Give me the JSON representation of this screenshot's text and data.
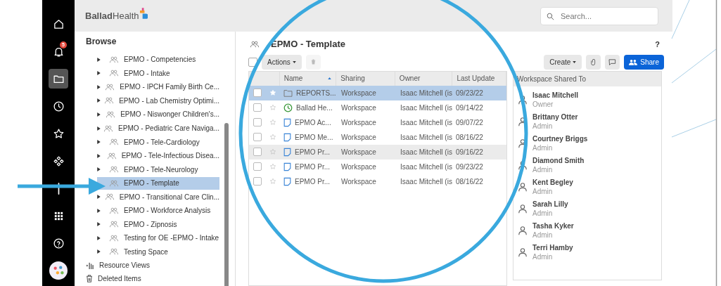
{
  "rail": [
    {
      "kind": "home",
      "selected": false
    },
    {
      "kind": "bell",
      "selected": false,
      "badge": "5"
    },
    {
      "kind": "folder",
      "selected": true
    },
    {
      "kind": "clock",
      "selected": false
    },
    {
      "kind": "star",
      "selected": false
    },
    {
      "kind": "diamonds",
      "selected": false
    },
    {
      "kind": "plus",
      "selected": false
    },
    {
      "kind": "apps",
      "selected": false
    },
    {
      "kind": "help",
      "selected": false
    },
    {
      "kind": "avatar",
      "selected": false
    }
  ],
  "header": {
    "logo": {
      "bold": "Ballad",
      "light": "Health"
    },
    "search": {
      "placeholder": "Search..."
    }
  },
  "sidebar": {
    "title": "Browse",
    "items": [
      {
        "label": "EPMO - Competencies",
        "selected": false,
        "has_children": true
      },
      {
        "label": "EPMO - Intake",
        "selected": false,
        "has_children": true
      },
      {
        "label": "EPMO - IPCH Family Birth Ce...",
        "selected": false,
        "has_children": true
      },
      {
        "label": "EPMO - Lab Chemistry Optimi...",
        "selected": false,
        "has_children": true
      },
      {
        "label": "EPMO - Niswonger Children's...",
        "selected": false,
        "has_children": true
      },
      {
        "label": "EPMO - Pediatric Care Naviga...",
        "selected": false,
        "has_children": true
      },
      {
        "label": "EPMO - Tele-Cardiology",
        "selected": false,
        "has_children": true
      },
      {
        "label": "EPMO - Tele-Infectious Disea...",
        "selected": false,
        "has_children": true
      },
      {
        "label": "EPMO - Tele-Neurology",
        "selected": false,
        "has_children": true
      },
      {
        "label": "EPMO - Template",
        "selected": true,
        "has_children": false
      },
      {
        "label": "EPMO - Transitional Care Clin...",
        "selected": false,
        "has_children": true
      },
      {
        "label": "EPMO - Workforce Analysis",
        "selected": false,
        "has_children": true
      },
      {
        "label": "EPMO - Zipnosis",
        "selected": false,
        "has_children": true
      },
      {
        "label": "Testing for OE -EPMO - Intake",
        "selected": false,
        "has_children": true
      },
      {
        "label": "Testing Space",
        "selected": false,
        "has_children": true
      }
    ],
    "footer": [
      {
        "kind": "views",
        "label": "Resource Views"
      },
      {
        "kind": "trash",
        "label": "Deleted Items"
      }
    ]
  },
  "workspace": {
    "select_all_checked": false,
    "title": "EPMO - Template",
    "help": "?",
    "actions": "Actions",
    "create": "Create",
    "share": "Share"
  },
  "table": {
    "columns": [
      "Name",
      "Sharing",
      "Owner",
      "Last Update"
    ],
    "rows": [
      {
        "kind": "folder",
        "name": "REPORTS...",
        "sharing": "Workspace",
        "owner": "Isaac Mitchell (is",
        "updated": "09/23/22",
        "checked": false,
        "selected": true,
        "hovered": false
      },
      {
        "kind": "dashboard",
        "name": "Ballad He...",
        "sharing": "Workspace",
        "owner": "Isaac Mitchell (is",
        "updated": "09/14/22",
        "checked": false,
        "selected": false,
        "hovered": false
      },
      {
        "kind": "sheet",
        "name": "EPMO Ac...",
        "sharing": "Workspace",
        "owner": "Isaac Mitchell (is",
        "updated": "09/07/22",
        "checked": false,
        "selected": false,
        "hovered": false
      },
      {
        "kind": "sheet",
        "name": "EPMO Me...",
        "sharing": "Workspace",
        "owner": "Isaac Mitchell (is",
        "updated": "08/16/22",
        "checked": false,
        "selected": false,
        "hovered": false
      },
      {
        "kind": "sheet",
        "name": "EPMO Pr...",
        "sharing": "Workspace",
        "owner": "Isaac Mitchell (is",
        "updated": "09/16/22",
        "checked": false,
        "selected": false,
        "hovered": true
      },
      {
        "kind": "sheet",
        "name": "EPMO Pr...",
        "sharing": "Workspace",
        "owner": "Isaac Mitchell (is",
        "updated": "09/23/22",
        "checked": false,
        "selected": false,
        "hovered": false
      },
      {
        "kind": "sheet",
        "name": "EPMO Pr...",
        "sharing": "Workspace",
        "owner": "Isaac Mitchell (is",
        "updated": "08/16/22",
        "checked": false,
        "selected": false,
        "hovered": false
      }
    ]
  },
  "shared": {
    "title": "Workspace Shared To",
    "people": [
      {
        "name": "Isaac Mitchell",
        "role": "Owner"
      },
      {
        "name": "Brittany Otter",
        "role": "Admin"
      },
      {
        "name": "Courtney Briggs",
        "role": "Admin"
      },
      {
        "name": "Diamond Smith",
        "role": "Admin"
      },
      {
        "name": "Kent Begley",
        "role": "Admin"
      },
      {
        "name": "Sarah Lilly",
        "role": "Admin"
      },
      {
        "name": "Tasha Kyker",
        "role": "Admin"
      },
      {
        "name": "Terri Hamby",
        "role": "Admin"
      }
    ]
  }
}
